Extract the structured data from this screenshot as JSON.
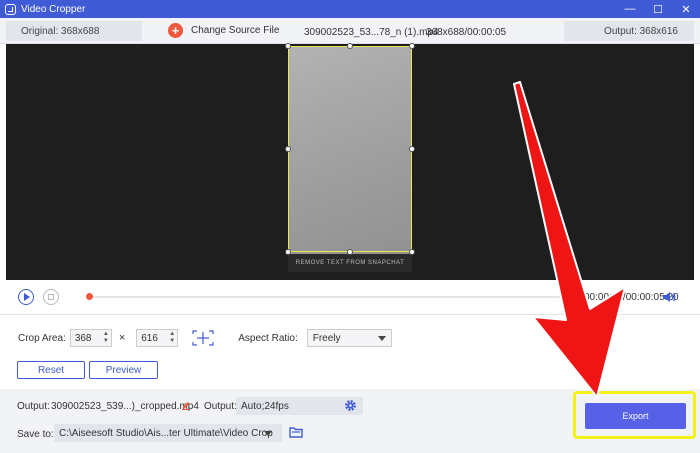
{
  "window": {
    "title": "Video Cropper",
    "minimize": "—",
    "maximize": "☐",
    "close": "✕"
  },
  "info_bar": {
    "original": "Original: 368x688",
    "change_source": "Change Source File",
    "file_name": "309002523_53...78_n (1).mp4",
    "file_meta": "368x688/00:00:05",
    "output": "Output: 368x616"
  },
  "preview": {
    "video_caption": "REMOVE TEXT FROM SNAPCHAT"
  },
  "playback": {
    "time": "00:00:00/00:00:05.20"
  },
  "crop": {
    "area_label": "Crop Area:",
    "width": "368",
    "height": "616",
    "times": "×",
    "aspect_label": "Aspect Ratio:",
    "aspect_value": "Freely"
  },
  "buttons": {
    "reset": "Reset",
    "preview": "Preview",
    "export": "Export"
  },
  "output": {
    "label": "Output:",
    "file_name": "309002523_539...)_cropped.mp4",
    "format_label": "Output:",
    "format_value": "Auto;24fps"
  },
  "save": {
    "label": "Save to:",
    "path": "C:\\Aiseesoft Studio\\Ais...ter Ultimate\\Video Crop"
  },
  "colors": {
    "accent": "#3f5bd6",
    "export": "#5661e8",
    "highlight": "#f2f21a",
    "arrow": "#f01515"
  }
}
